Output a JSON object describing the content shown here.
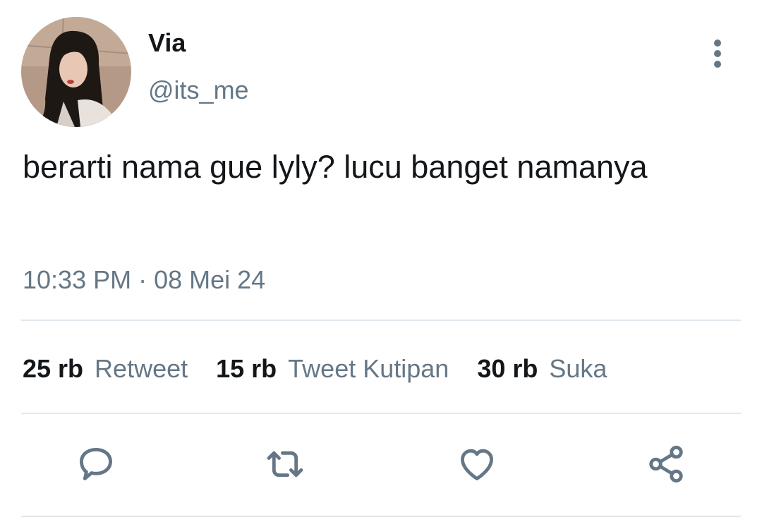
{
  "user": {
    "display_name": "Via",
    "handle": "@its_me"
  },
  "tweet": {
    "text": "berarti nama gue lyly? lucu banget namanya",
    "timestamp": "10:33 PM · 08 Mei 24"
  },
  "stats": [
    {
      "count": "25 rb",
      "label": "Retweet"
    },
    {
      "count": "15 rb",
      "label": "Tweet Kutipan"
    },
    {
      "count": "30 rb",
      "label": "Suka"
    }
  ],
  "actions": {
    "reply_icon": "comment-icon",
    "retweet_icon": "retweet-icon",
    "like_icon": "heart-icon",
    "share_icon": "share-icon",
    "more_icon": "more-vertical-icon"
  },
  "colors": {
    "text_primary": "#14171a",
    "text_secondary": "#657786",
    "divider": "#e1e8ed",
    "background": "#ffffff"
  }
}
